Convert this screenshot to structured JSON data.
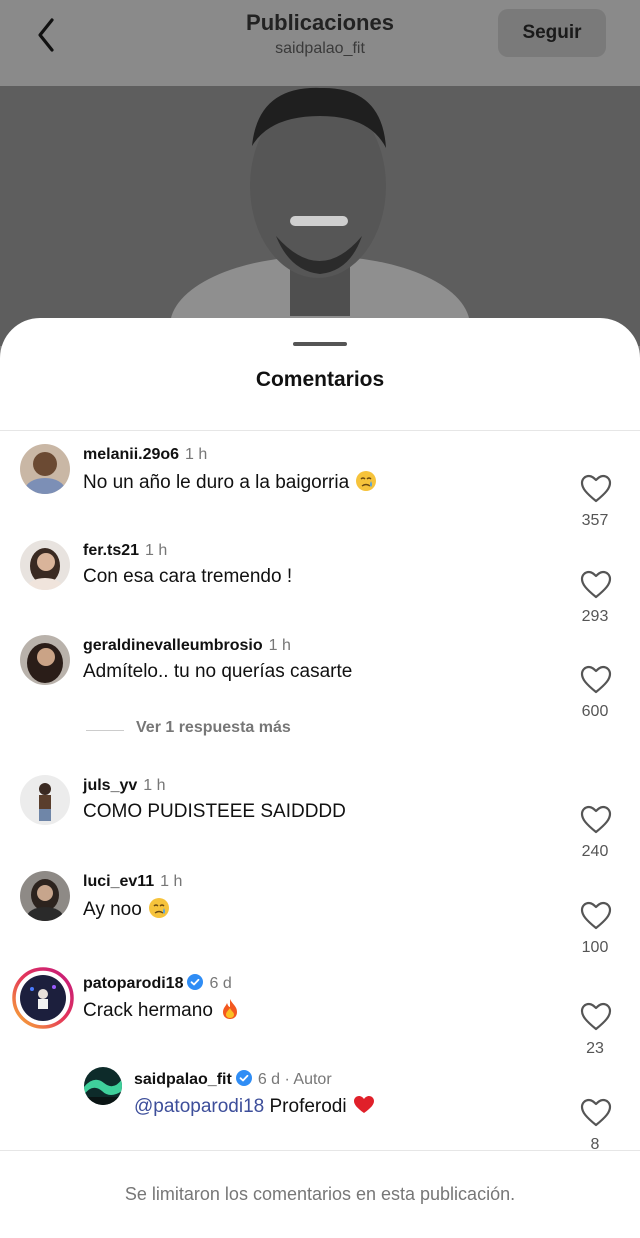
{
  "header": {
    "title": "Publicaciones",
    "subtitle": "saidpalao_fit",
    "follow_label": "Seguir",
    "back_icon": "chevron-left-icon"
  },
  "sheet": {
    "title": "Comentarios",
    "more_replies": "Ver 1 respuesta más",
    "footer": "Se limitaron los comentarios en esta publicación."
  },
  "comments": [
    {
      "user": "melanii.29o6",
      "time": "1 h",
      "text": "No un año le duro a la baigorria",
      "emoji": "crying-face",
      "likes": "357"
    },
    {
      "user": "fer.ts21",
      "time": "1 h",
      "text": "Con esa cara tremendo !",
      "likes": "293"
    },
    {
      "user": "geraldinevalleumbrosio",
      "time": "1 h",
      "text": "Admítelo.. tu no querías casarte",
      "likes": "600"
    },
    {
      "user": "juls_yv",
      "time": "1 h",
      "text": "COMO PUDISTEEE SAIDDDD",
      "likes": "240"
    },
    {
      "user": "luci_ev11",
      "time": "1 h",
      "text": "Ay noo",
      "emoji": "crying-face",
      "likes": "100"
    },
    {
      "user": "patoparodi18",
      "verified": true,
      "time": "6 d",
      "text": "Crack hermano",
      "emoji": "fire",
      "likes": "23"
    }
  ],
  "reply": {
    "user": "saidpalao_fit",
    "verified": true,
    "time": "6 d",
    "author_label": "Autor",
    "mention": "@patoparodi18",
    "text": "Proferodi",
    "emoji": "red-heart",
    "likes": "8"
  },
  "colors": {
    "verified": "#2f8df5",
    "mention": "#3d4e9a",
    "like_outline": "#555555"
  }
}
